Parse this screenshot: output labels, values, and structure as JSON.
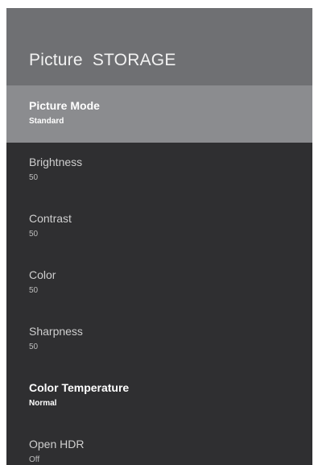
{
  "header": {
    "title": "Picture  STORAGE"
  },
  "menu": {
    "items": [
      {
        "label": "Picture Mode",
        "value": "Standard"
      },
      {
        "label": "Brightness",
        "value": "50"
      },
      {
        "label": "Contrast",
        "value": "50"
      },
      {
        "label": "Color",
        "value": "50"
      },
      {
        "label": "Sharpness",
        "value": "50"
      },
      {
        "label": "Color Temperature",
        "value": "Normal"
      },
      {
        "label": "Open HDR",
        "value": "Off"
      }
    ]
  },
  "colors": {
    "header_bg": "#6f7073",
    "panel_bg": "#2f2f31",
    "selected_bg": "#8b8c8f"
  }
}
